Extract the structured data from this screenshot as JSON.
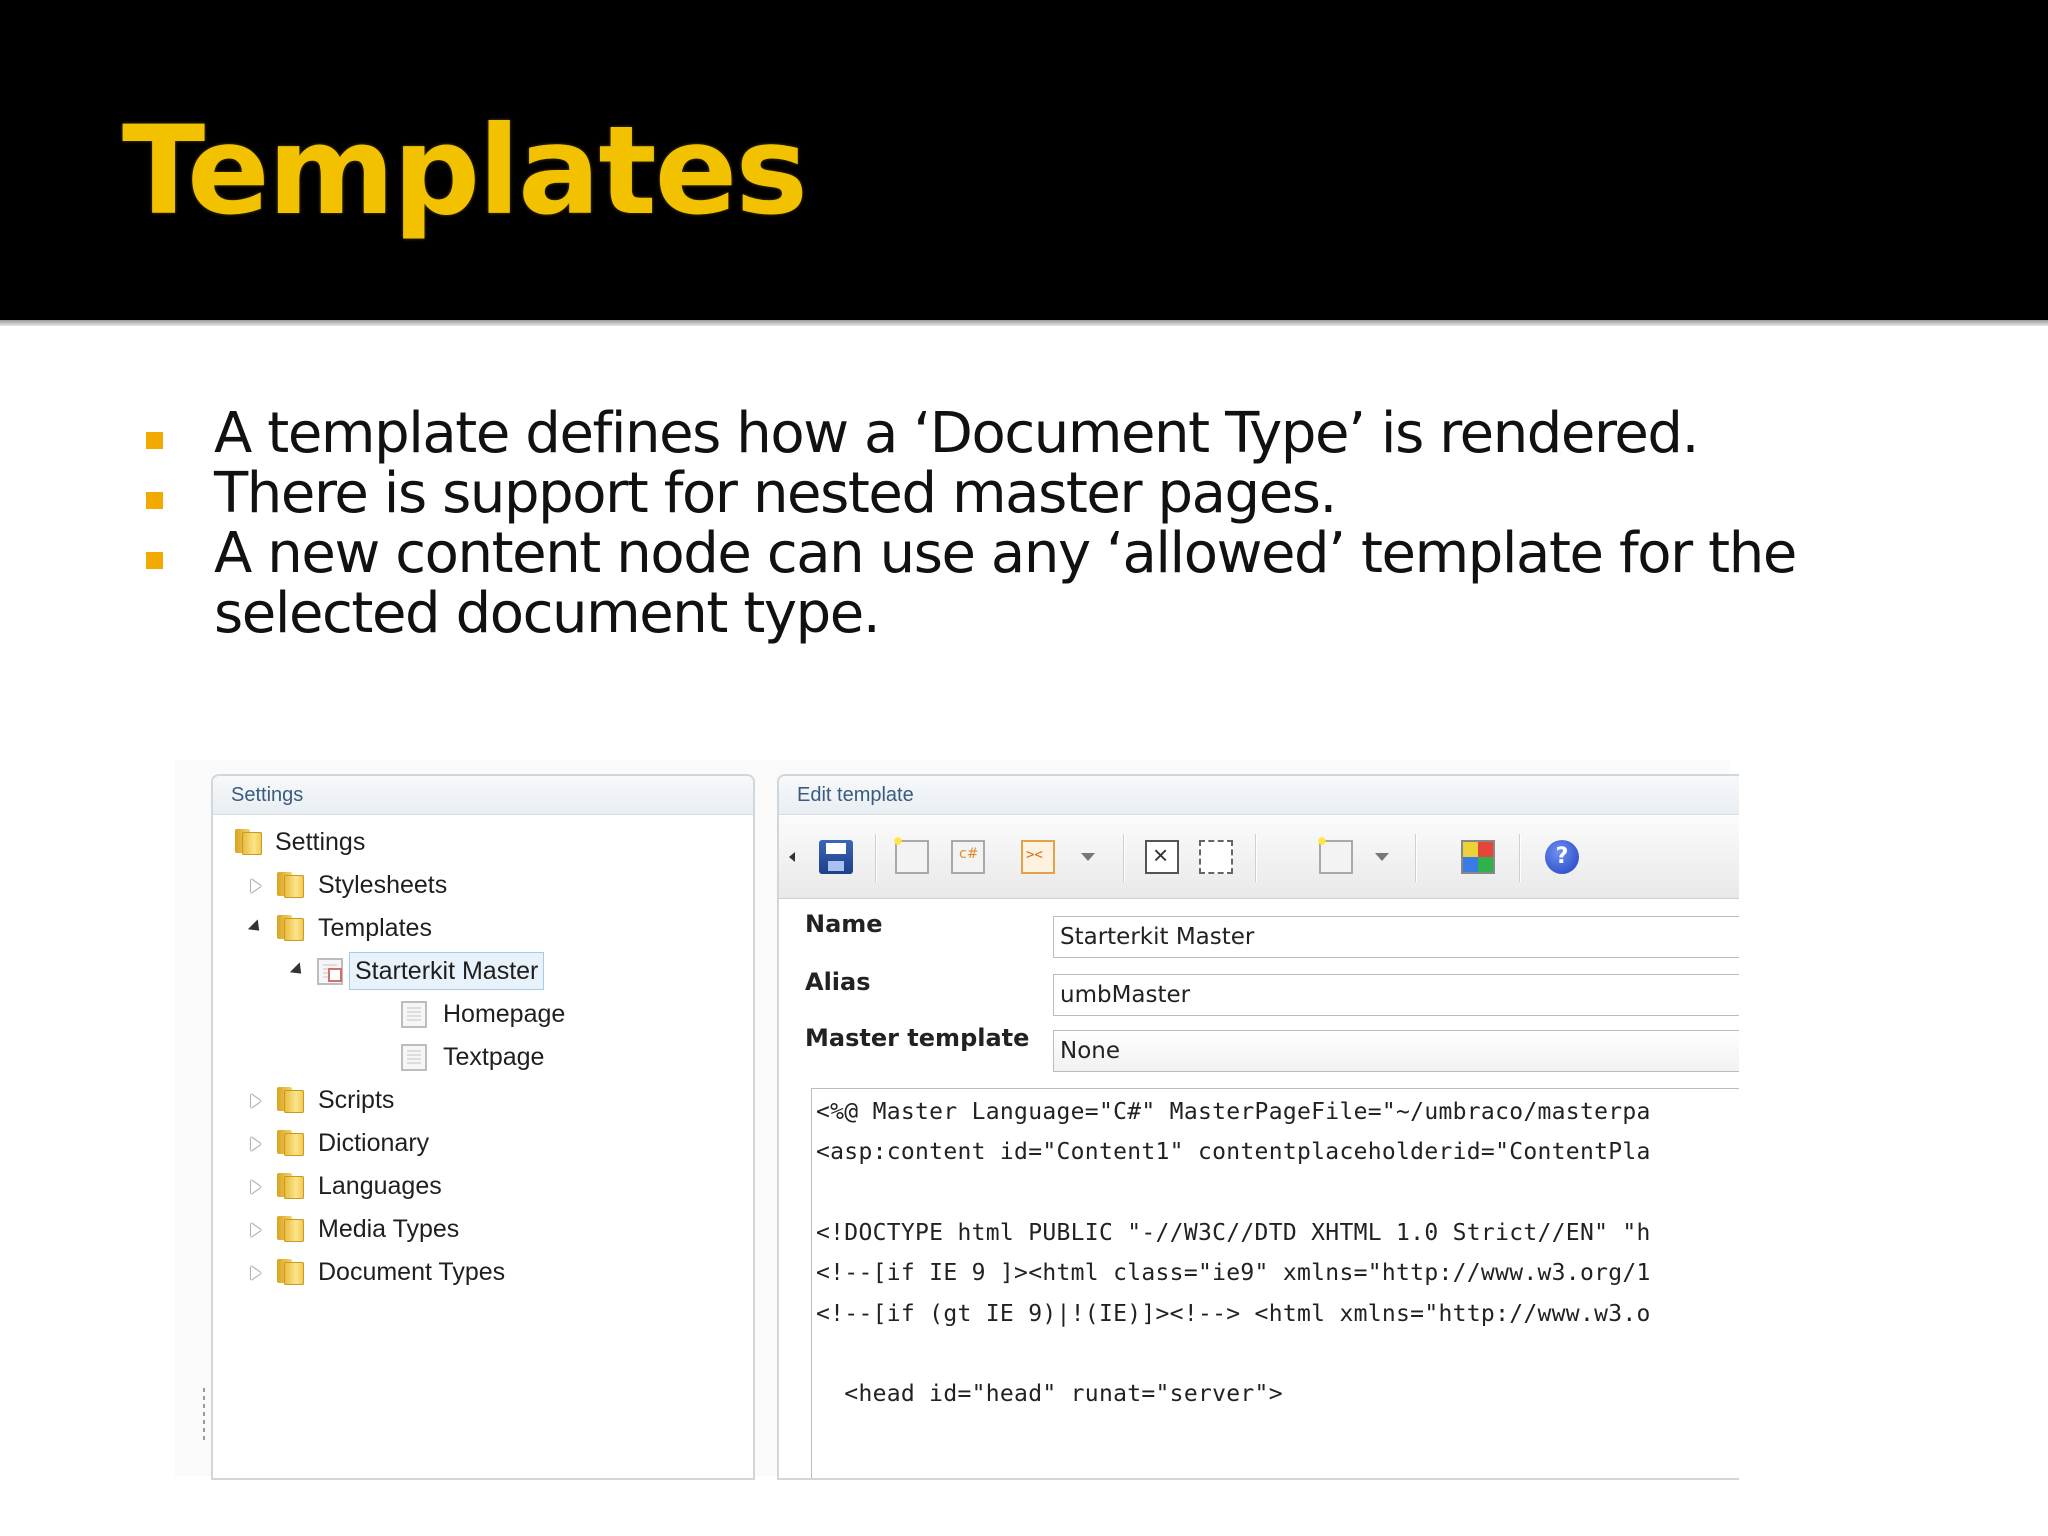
{
  "slide": {
    "title": "Templates",
    "bullets": [
      "A template defines how a ‘Document Type’ is rendered.",
      "There is support for nested master pages.",
      "A new content node can use any ‘allowed’ template for the selected document type."
    ],
    "accent_color": "#f2c200",
    "bullet_color": "#f2a900"
  },
  "settings_panel": {
    "header": "Settings",
    "tree": [
      {
        "label": "Settings",
        "icon": "folder-icon",
        "depth": 0,
        "expander": "none"
      },
      {
        "label": "Stylesheets",
        "icon": "folder-icon",
        "depth": 1,
        "expander": "collapsed"
      },
      {
        "label": "Templates",
        "icon": "folder-icon",
        "depth": 1,
        "expander": "expanded"
      },
      {
        "label": "Starterkit Master",
        "icon": "master-template-icon",
        "depth": 2,
        "expander": "expanded",
        "selected": true
      },
      {
        "label": "Homepage",
        "icon": "template-icon",
        "depth": 3,
        "expander": "none"
      },
      {
        "label": "Textpage",
        "icon": "template-icon",
        "depth": 3,
        "expander": "none"
      },
      {
        "label": "Scripts",
        "icon": "folder-icon",
        "depth": 1,
        "expander": "collapsed"
      },
      {
        "label": "Dictionary",
        "icon": "folder-icon",
        "depth": 1,
        "expander": "collapsed"
      },
      {
        "label": "Languages",
        "icon": "folder-icon",
        "depth": 1,
        "expander": "collapsed"
      },
      {
        "label": "Media Types",
        "icon": "folder-icon",
        "depth": 1,
        "expander": "collapsed"
      },
      {
        "label": "Document Types",
        "icon": "folder-icon",
        "depth": 1,
        "expander": "collapsed"
      }
    ]
  },
  "edit_panel": {
    "header": "Edit template",
    "toolbar_icons": [
      "save-icon",
      "insert-field-icon",
      "insert-csharp-icon",
      "insert-macro-icon",
      "insert-dropdown-icon",
      "delete-placeholder-icon",
      "placeholder-icon",
      "insert-content-icon",
      "content-dropdown-icon",
      "colors-icon",
      "help-icon"
    ],
    "fields": {
      "name_label": "Name",
      "name_value": "Starterkit Master",
      "alias_label": "Alias",
      "alias_value": "umbMaster",
      "master_label": "Master template",
      "master_value": "None"
    },
    "code_lines": [
      "<%@ Master Language=\"C#\" MasterPageFile=\"~/umbraco/masterpa",
      "<asp:content id=\"Content1\" contentplaceholderid=\"ContentPla",
      "",
      "<!DOCTYPE html PUBLIC \"-//W3C//DTD XHTML 1.0 Strict//EN\" \"h",
      "<!--[if IE 9 ]><html class=\"ie9\" xmlns=\"http://www.w3.org/1",
      "<!--[if (gt IE 9)|!(IE)]><!--> <html xmlns=\"http://www.w3.o",
      "",
      "  <head id=\"head\" runat=\"server\">"
    ]
  }
}
